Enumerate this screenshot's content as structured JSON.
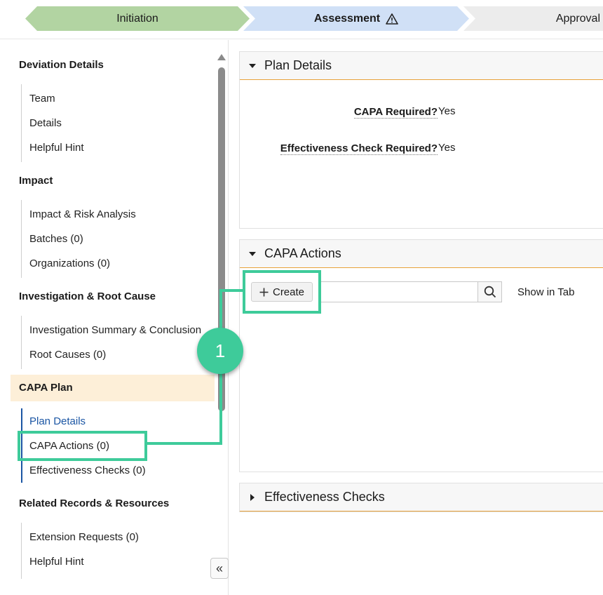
{
  "progress": {
    "stages": [
      {
        "label": "Initiation"
      },
      {
        "label": "Assessment"
      },
      {
        "label": "Approval"
      }
    ]
  },
  "sidebar": {
    "sections": [
      {
        "title": "Deviation Details",
        "items": [
          "Team",
          "Details",
          "Helpful Hint"
        ]
      },
      {
        "title": "Impact",
        "items": [
          "Impact & Risk Analysis",
          "Batches (0)",
          "Organizations (0)"
        ]
      },
      {
        "title": "Investigation & Root Cause",
        "items": [
          "Investigation Summary & Conclusion",
          "Root Causes (0)"
        ]
      },
      {
        "title": "CAPA Plan",
        "items": [
          "Plan Details",
          "CAPA Actions (0)",
          "Effectiveness Checks (0)"
        ]
      },
      {
        "title": "Related Records & Resources",
        "items": [
          "Extension Requests (0)",
          "Helpful Hint"
        ]
      }
    ],
    "collapse_glyph": "«"
  },
  "plan_details": {
    "title": "Plan Details",
    "fields": [
      {
        "label": "CAPA Required?",
        "value": "Yes"
      },
      {
        "label": "Effectiveness Check Required?",
        "value": "Yes"
      }
    ]
  },
  "capa_actions": {
    "title": "CAPA Actions",
    "create_label": "Create",
    "search_value": "",
    "show_in_tab": "Show in Tab"
  },
  "effectiveness": {
    "title": "Effectiveness Checks"
  },
  "callout": {
    "number": "1",
    "color": "#3ecb9a"
  },
  "colors": {
    "stage_done": "#b2d4a2",
    "stage_current": "#d0e0f6",
    "stage_future": "#ececec",
    "section_highlight": "#fdefd8",
    "accent_line": "#e8a23a",
    "link_active": "#1b56a4"
  }
}
